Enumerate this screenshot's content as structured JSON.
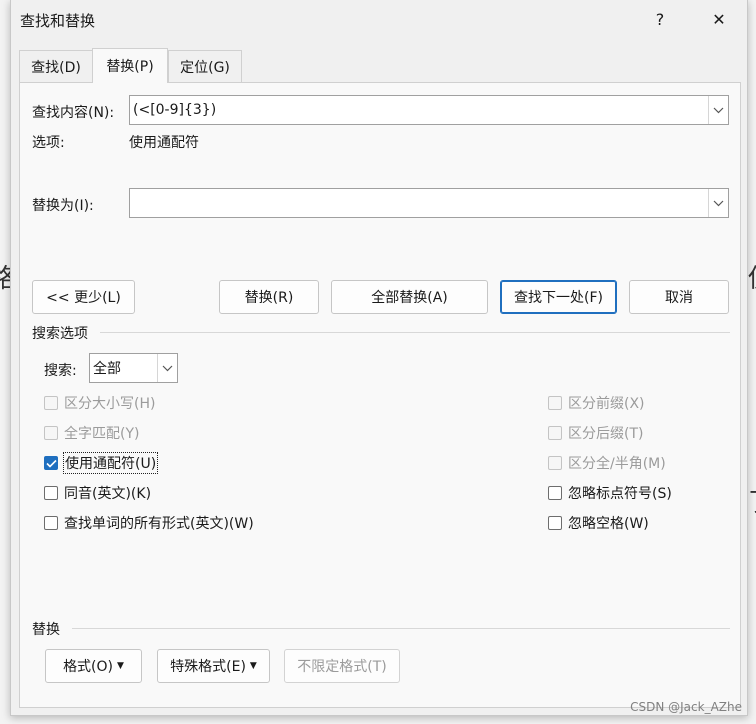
{
  "backdrop": {
    "glyph_left_1": "格",
    "glyph_right_1": "仪",
    "glyph_right_2": "了"
  },
  "window": {
    "title": "查找和替换",
    "help_label": "?",
    "close_label": "✕"
  },
  "tabs": [
    {
      "label": "查找(D)",
      "active": false
    },
    {
      "label": "替换(P)",
      "active": true
    },
    {
      "label": "定位(G)",
      "active": false
    }
  ],
  "find": {
    "label": "查找内容(N):",
    "value": "(<[0-9]{3})"
  },
  "options": {
    "label": "选项:",
    "value": "使用通配符"
  },
  "replace": {
    "label": "替换为(I):",
    "value": ""
  },
  "buttons": {
    "less": "<< 更少(L)",
    "replace": "替换(R)",
    "replace_all": "全部替换(A)",
    "find_next": "查找下一处(F)",
    "cancel": "取消"
  },
  "search_options": {
    "heading": "搜索选项",
    "search_label": "搜索:",
    "search_value": "全部",
    "left": [
      {
        "label": "区分大小写(H)",
        "checked": false,
        "disabled": true
      },
      {
        "label": "全字匹配(Y)",
        "checked": false,
        "disabled": true
      },
      {
        "label": "使用通配符(U)",
        "checked": true,
        "disabled": false
      },
      {
        "label": "同音(英文)(K)",
        "checked": false,
        "disabled": false
      },
      {
        "label": "查找单词的所有形式(英文)(W)",
        "checked": false,
        "disabled": false
      }
    ],
    "right": [
      {
        "label": "区分前缀(X)",
        "checked": false,
        "disabled": true
      },
      {
        "label": "区分后缀(T)",
        "checked": false,
        "disabled": true
      },
      {
        "label": "区分全/半角(M)",
        "checked": false,
        "disabled": true
      },
      {
        "label": "忽略标点符号(S)",
        "checked": false,
        "disabled": false
      },
      {
        "label": "忽略空格(W)",
        "checked": false,
        "disabled": false
      }
    ]
  },
  "replace_section": {
    "heading": "替换",
    "format_button": "格式(O)",
    "special_button": "特殊格式(E)",
    "no_format_button": "不限定格式(T)"
  },
  "watermark": "CSDN @Jack_AZhe"
}
